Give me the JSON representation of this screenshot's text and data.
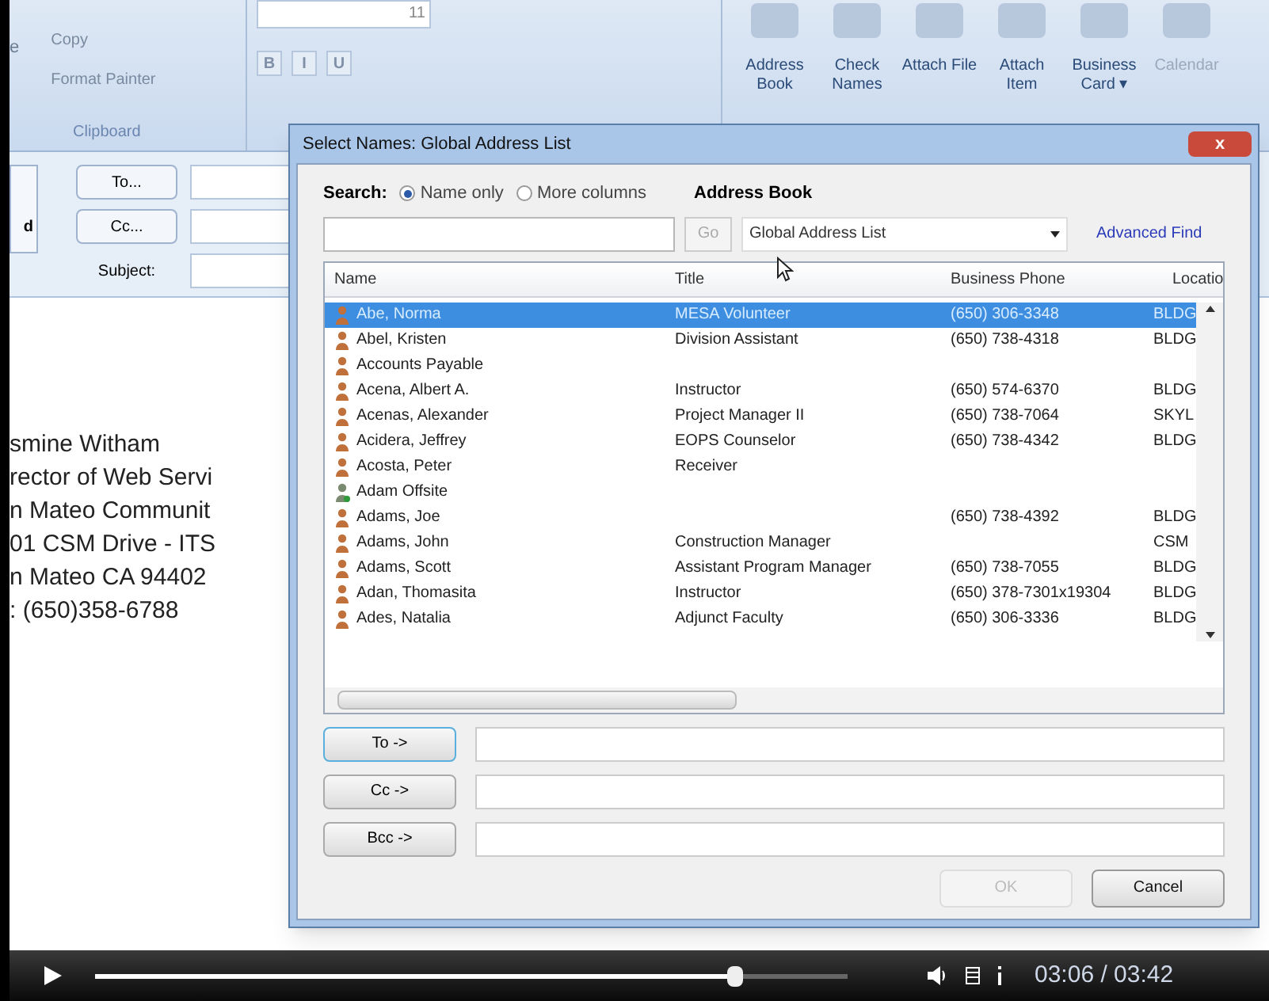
{
  "ribbon": {
    "paste_partial": "e",
    "clipboard_items": [
      "Copy",
      "Format Painter"
    ],
    "clipboard_label": "Clipboard",
    "font_size": "11",
    "format_buttons": [
      "B",
      "I",
      "U"
    ],
    "commands": [
      {
        "label": "Address Book",
        "disabled": false
      },
      {
        "label": "Check Names",
        "disabled": false
      },
      {
        "label": "Attach File",
        "disabled": false
      },
      {
        "label": "Attach Item",
        "disabled": false
      },
      {
        "label": "Business Card ▾",
        "disabled": false
      },
      {
        "label": "Calendar",
        "disabled": true
      }
    ]
  },
  "compose": {
    "send_partial": "d",
    "address_buttons": [
      "To...",
      "Cc..."
    ],
    "subject_label": "Subject:"
  },
  "signature": [
    "smine Witham",
    "rector of Web Servi",
    "n Mateo Communit",
    "01 CSM Drive - ITS",
    "n Mateo CA 94402",
    ": (650)358-6788"
  ],
  "dialog": {
    "title": "Select Names: Global Address List",
    "close": "x",
    "search_label": "Search:",
    "search_options": [
      {
        "label": "Name only",
        "selected": true
      },
      {
        "label": "More columns",
        "selected": false
      }
    ],
    "go_button": "Go",
    "address_book_label": "Address Book",
    "address_book_value": "Global Address List",
    "advanced_find": "Advanced Find",
    "columns": [
      "Name",
      "Title",
      "Business Phone",
      "Locatio"
    ],
    "rows": [
      {
        "kind": "user",
        "name": "Abe, Norma",
        "title": "MESA Volunteer",
        "phone": "(650) 306-3348",
        "location": "BLDG",
        "selected": true
      },
      {
        "kind": "user",
        "name": "Abel, Kristen",
        "title": "Division Assistant",
        "phone": "(650) 738-4318",
        "location": "BLDG",
        "selected": false
      },
      {
        "kind": "user",
        "name": "Accounts Payable",
        "title": "",
        "phone": "",
        "location": "",
        "selected": false
      },
      {
        "kind": "user",
        "name": "Acena, Albert A.",
        "title": "Instructor",
        "phone": "(650) 574-6370",
        "location": "BLDG",
        "selected": false
      },
      {
        "kind": "user",
        "name": "Acenas, Alexander",
        "title": "Project Manager II",
        "phone": "(650) 738-7064",
        "location": "SKYL",
        "selected": false
      },
      {
        "kind": "user",
        "name": "Acidera, Jeffrey",
        "title": "EOPS Counselor",
        "phone": "(650) 738-4342",
        "location": "BLDG",
        "selected": false
      },
      {
        "kind": "user",
        "name": "Acosta, Peter",
        "title": "Receiver",
        "phone": "",
        "location": "",
        "selected": false
      },
      {
        "kind": "contact",
        "name": "Adam Offsite",
        "title": "",
        "phone": "",
        "location": "",
        "selected": false
      },
      {
        "kind": "user",
        "name": "Adams, Joe",
        "title": "",
        "phone": "(650) 738-4392",
        "location": "BLDG",
        "selected": false
      },
      {
        "kind": "user",
        "name": "Adams, John",
        "title": "Construction Manager",
        "phone": "",
        "location": "CSM",
        "selected": false
      },
      {
        "kind": "user",
        "name": "Adams, Scott",
        "title": "Assistant Program Manager",
        "phone": "(650) 738-7055",
        "location": "BLDG",
        "selected": false
      },
      {
        "kind": "user",
        "name": "Adan, Thomasita",
        "title": "Instructor",
        "phone": "(650) 378-7301x19304",
        "location": "BLDG",
        "selected": false
      },
      {
        "kind": "user",
        "name": "Ades, Natalia",
        "title": "Adjunct Faculty",
        "phone": "(650) 306-3336",
        "location": "BLDG",
        "selected": false
      }
    ],
    "recipient_buttons": [
      "To ->",
      "Cc ->",
      "Bcc ->"
    ],
    "buttons": [
      {
        "label": "OK",
        "disabled": true
      },
      {
        "label": "Cancel",
        "disabled": false
      }
    ]
  },
  "video": {
    "level": 0.86,
    "time": "03:06 / 03:42"
  }
}
